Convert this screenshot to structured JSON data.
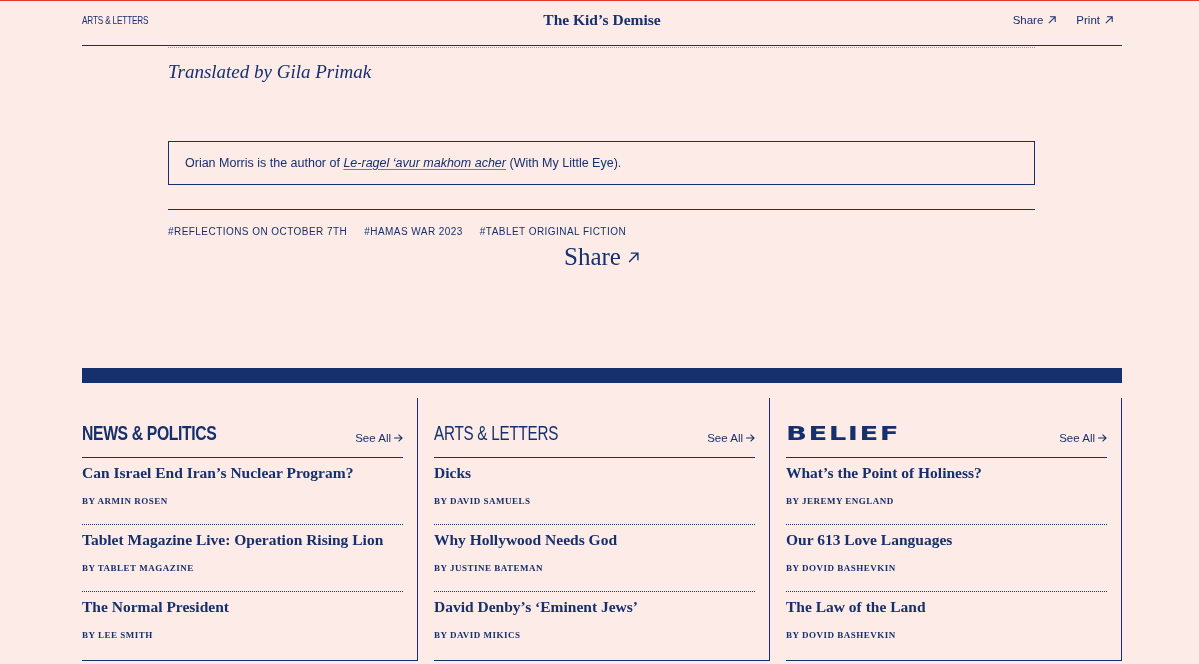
{
  "header": {
    "section": "ARTS & LETTERS",
    "title": "The Kid’s Demise",
    "actions": [
      {
        "label": "Share"
      },
      {
        "label": "Print"
      }
    ]
  },
  "article": {
    "translator_credit": "Translated by Gila Primak",
    "author_note": {
      "text_before": "Orian Morris is the author of",
      "book_title": "Le-ragel ‘avur makhom acher",
      "text_after": "(With My Little Eye)."
    },
    "tags": [
      "#REFLECTIONS ON OCTOBER 7TH",
      "#HAMAS WAR 2023",
      "#TABLET ORIGINAL FICTION"
    ],
    "share_label": "Share"
  },
  "sections": [
    {
      "kind": "heavy",
      "title": "NEWS & POLITICS",
      "see_all": "See All",
      "stories": [
        {
          "title": "Can Israel End Iran’s Nuclear Program?",
          "byline": "BY ARMIN ROSEN"
        },
        {
          "title": "Tablet Magazine Live: Operation Rising Lion",
          "byline": "BY TABLET MAGAZINE"
        },
        {
          "title": "The Normal President",
          "byline": "BY LEE SMITH"
        }
      ]
    },
    {
      "kind": "light",
      "title": "ARTS & LETTERS",
      "see_all": "See All",
      "stories": [
        {
          "title": "Dicks",
          "byline": "BY DAVID SAMUELS"
        },
        {
          "title": "Why Hollywood Needs God",
          "byline": "BY JUSTINE BATEMAN"
        },
        {
          "title": "David Denby’s ‘Eminent Jews’",
          "byline": "BY DAVID MIKICS"
        }
      ]
    },
    {
      "kind": "wide",
      "title": "BELIEF",
      "see_all": "See All",
      "stories": [
        {
          "title": "What’s the Point of Holiness?",
          "byline": "BY JEREMY ENGLAND"
        },
        {
          "title": "Our 613 Love Languages",
          "byline": "BY DOVID BASHEVKIN"
        },
        {
          "title": "The Law of the Land",
          "byline": "BY DOVID BASHEVKIN"
        }
      ]
    }
  ]
}
